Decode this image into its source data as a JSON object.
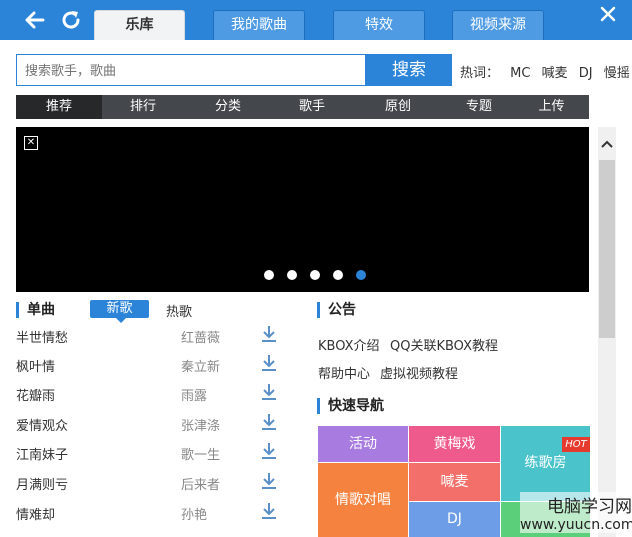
{
  "header": {
    "tabs": [
      {
        "label": "乐库",
        "active": true
      },
      {
        "label": "我的歌曲",
        "active": false
      },
      {
        "label": "特效",
        "active": false
      },
      {
        "label": "视频来源",
        "active": false
      }
    ]
  },
  "search": {
    "placeholder": "搜索歌手，歌曲",
    "button_label": "搜索",
    "hotwords_label": "热词：",
    "hotwords": [
      "MC",
      "喊麦",
      "DJ",
      "慢摇"
    ]
  },
  "categories": [
    "推荐",
    "排行",
    "分类",
    "歌手",
    "原创",
    "专题",
    "上传"
  ],
  "active_category": "推荐",
  "banner": {
    "slide_count": 5,
    "active_slide": 5
  },
  "singles": {
    "title": "单曲",
    "tabs": [
      "新歌",
      "热歌"
    ],
    "songs": [
      {
        "name": "半世情愁",
        "artist": "红蔷薇"
      },
      {
        "name": "枫叶情",
        "artist": "秦立新"
      },
      {
        "name": "花瓣雨",
        "artist": "雨露"
      },
      {
        "name": "爱情观众",
        "artist": "张津涤"
      },
      {
        "name": "江南妹子",
        "artist": "歌一生"
      },
      {
        "name": "月满则亏",
        "artist": "后来者"
      },
      {
        "name": "情难却",
        "artist": "孙艳"
      }
    ]
  },
  "notice": {
    "title": "公告",
    "links": [
      "KBOX介绍",
      "QQ关联KBOX教程",
      "帮助中心",
      "虚拟视频教程"
    ]
  },
  "quicknav": {
    "title": "快速导航",
    "tiles": [
      "活动",
      "黄梅戏",
      "练歌房",
      "情歌对唱",
      "喊麦",
      "DJ"
    ],
    "hot_badge": "HOT",
    "colors": {
      "huodong": "#a77be0",
      "huangmeixi": "#ee5a8b",
      "liangefang": "#4bc3cb",
      "qingge": "#f5833f",
      "hanmai": "#f26f6a",
      "dj": "#6d9de6"
    }
  },
  "watermark": {
    "line1": "电脑学习网",
    "line2": "www.yuucn.com"
  },
  "colors": {
    "accent": "#2b84d8",
    "category_bar": "#44484c"
  }
}
